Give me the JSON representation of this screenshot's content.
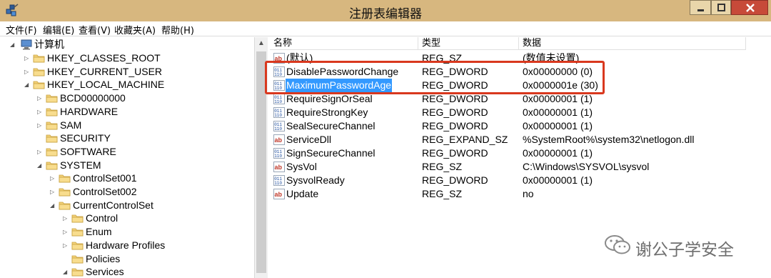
{
  "window": {
    "title": "注册表编辑器",
    "icon": "regedit-icon"
  },
  "menu": [
    "文件(F)",
    "编辑(E)",
    "查看(V)",
    "收藏夹(A)",
    "帮助(H)"
  ],
  "tree": {
    "root": "计算机",
    "nodes": [
      {
        "label": "HKEY_CLASSES_ROOT",
        "expander": "▷"
      },
      {
        "label": "HKEY_CURRENT_USER",
        "expander": "▷"
      },
      {
        "label": "HKEY_LOCAL_MACHINE",
        "expander": "◢"
      },
      {
        "label": "BCD00000000",
        "expander": "▷"
      },
      {
        "label": "HARDWARE",
        "expander": "▷"
      },
      {
        "label": "SAM",
        "expander": "▷"
      },
      {
        "label": "SECURITY",
        "expander": ""
      },
      {
        "label": "SOFTWARE",
        "expander": "▷"
      },
      {
        "label": "SYSTEM",
        "expander": "◢"
      },
      {
        "label": "ControlSet001",
        "expander": "▷"
      },
      {
        "label": "ControlSet002",
        "expander": "▷"
      },
      {
        "label": "CurrentControlSet",
        "expander": "◢"
      },
      {
        "label": "Control",
        "expander": "▷"
      },
      {
        "label": "Enum",
        "expander": "▷"
      },
      {
        "label": "Hardware Profiles",
        "expander": "▷"
      },
      {
        "label": "Policies",
        "expander": ""
      },
      {
        "label": "Services",
        "expander": "◢"
      }
    ]
  },
  "columns": {
    "name": "名称",
    "type": "类型",
    "data": "数据"
  },
  "values": [
    {
      "name": "(默认)",
      "type": "REG_SZ",
      "data": "(数值未设置)",
      "icon": "string-value-icon"
    },
    {
      "name": "DisablePasswordChange",
      "type": "REG_DWORD",
      "data": "0x00000000 (0)",
      "icon": "binary-value-icon"
    },
    {
      "name": "MaximumPasswordAge",
      "type": "REG_DWORD",
      "data": "0x0000001e (30)",
      "icon": "binary-value-icon",
      "selected": true
    },
    {
      "name": "RequireSignOrSeal",
      "type": "REG_DWORD",
      "data": "0x00000001 (1)",
      "icon": "binary-value-icon"
    },
    {
      "name": "RequireStrongKey",
      "type": "REG_DWORD",
      "data": "0x00000001 (1)",
      "icon": "binary-value-icon"
    },
    {
      "name": "SealSecureChannel",
      "type": "REG_DWORD",
      "data": "0x00000001 (1)",
      "icon": "binary-value-icon"
    },
    {
      "name": "ServiceDll",
      "type": "REG_EXPAND_SZ",
      "data": "%SystemRoot%\\system32\\netlogon.dll",
      "icon": "string-value-icon"
    },
    {
      "name": "SignSecureChannel",
      "type": "REG_DWORD",
      "data": "0x00000001 (1)",
      "icon": "binary-value-icon"
    },
    {
      "name": "SysVol",
      "type": "REG_SZ",
      "data": "C:\\Windows\\SYSVOL\\sysvol",
      "icon": "string-value-icon"
    },
    {
      "name": "SysvolReady",
      "type": "REG_DWORD",
      "data": "0x00000001 (1)",
      "icon": "binary-value-icon"
    },
    {
      "name": "Update",
      "type": "REG_SZ",
      "data": "no",
      "icon": "string-value-icon"
    }
  ],
  "watermark": "谢公子学安全",
  "colors": {
    "titlebar": "#d7b77f",
    "selection": "#3399ff",
    "highlight_box": "#d9381e",
    "close_button": "#c74a39"
  }
}
